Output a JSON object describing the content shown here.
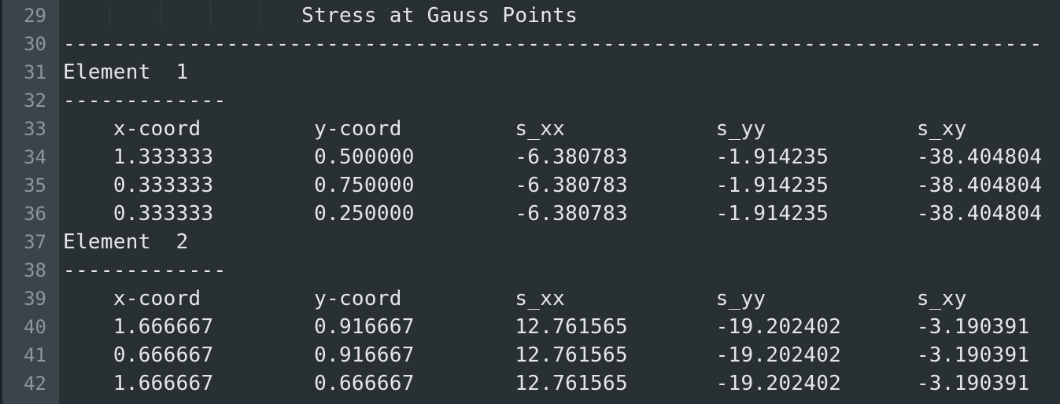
{
  "editor": {
    "lines": [
      {
        "number": "29",
        "text": "                   Stress at Gauss Points"
      },
      {
        "number": "30",
        "text": "------------------------------------------------------------------------------"
      },
      {
        "number": "31",
        "text": "Element  1"
      },
      {
        "number": "32",
        "text": "-------------"
      },
      {
        "number": "33",
        "text": "    x-coord         y-coord         s_xx            s_yy            s_xy"
      },
      {
        "number": "34",
        "text": "    1.333333        0.500000        -6.380783       -1.914235       -38.404804"
      },
      {
        "number": "35",
        "text": "    0.333333        0.750000        -6.380783       -1.914235       -38.404804"
      },
      {
        "number": "36",
        "text": "    0.333333        0.250000        -6.380783       -1.914235       -38.404804"
      },
      {
        "number": "37",
        "text": "Element  2"
      },
      {
        "number": "38",
        "text": "-------------"
      },
      {
        "number": "39",
        "text": "    x-coord         y-coord         s_xx            s_yy            s_xy"
      },
      {
        "number": "40",
        "text": "    1.666667        0.916667        12.761565       -19.202402      -3.190391"
      },
      {
        "number": "41",
        "text": "    0.666667        0.916667        12.761565       -19.202402      -3.190391"
      },
      {
        "number": "42",
        "text": "    1.666667        0.666667        12.761565       -19.202402      -3.190391"
      }
    ]
  },
  "colors": {
    "background": "#283034",
    "gutter": "#3a4549",
    "line_number": "#8b979c",
    "text": "#e6e6e6"
  }
}
